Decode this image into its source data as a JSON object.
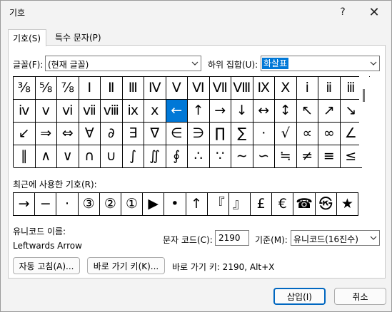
{
  "window": {
    "title": "기호",
    "help_glyph": "?",
    "close_glyph": "✕"
  },
  "tabs": [
    {
      "label": "기호(S)",
      "active": true
    },
    {
      "label": "특수 문자(P)",
      "active": false
    }
  ],
  "font": {
    "label": "글꼴(F):",
    "value": "(현재 글꼴)"
  },
  "subset": {
    "label": "하위 집합(U):",
    "value": "화살표"
  },
  "symbols": [
    "⅜",
    "⅝",
    "⅞",
    "Ⅰ",
    "Ⅱ",
    "Ⅲ",
    "Ⅳ",
    "Ⅴ",
    "Ⅵ",
    "Ⅶ",
    "Ⅷ",
    "Ⅸ",
    "Ⅹ",
    "ⅰ",
    "ⅱ",
    "ⅲ",
    "ⅳ",
    "ⅴ",
    "ⅵ",
    "ⅶ",
    "ⅷ",
    "ⅸ",
    "ⅹ",
    "←",
    "↑",
    "→",
    "↓",
    "↔",
    "↕",
    "↖",
    "↗",
    "↘",
    "↙",
    "⇒",
    "⇔",
    "∀",
    "∂",
    "∃",
    "∇",
    "∈",
    "∋",
    "∏",
    "∑",
    "·",
    "√",
    "∝",
    "∞",
    "∠",
    "∥",
    "∧",
    "∨",
    "∩",
    "∪",
    "∫",
    "∬",
    "∮",
    "∴",
    "∵",
    "∼",
    "∽",
    "≒",
    "≠",
    "≡",
    "≤"
  ],
  "selected_index": 23,
  "recent": {
    "label": "최근에 사용한 기호(R):",
    "symbols": [
      "→",
      "−",
      "·",
      "③",
      "②",
      "①",
      "▶",
      "•",
      "↑",
      "『",
      "』",
      "£",
      "€",
      "☎",
      "㉿",
      "★"
    ]
  },
  "unicode_name": {
    "label": "유니코드 이름:",
    "value": "Leftwards Arrow"
  },
  "char_code": {
    "label": "문자 코드(C):",
    "value": "2190"
  },
  "from": {
    "label": "기준(M):",
    "value": "유니코드(16진수)"
  },
  "buttons": {
    "autocorrect": "자동 고침(A)...",
    "shortcut_key": "바로 가기 키(K)...",
    "insert": "삽입(I)",
    "cancel": "취소"
  },
  "shortcut_text": "바로 가기 키: 2190, Alt+X"
}
